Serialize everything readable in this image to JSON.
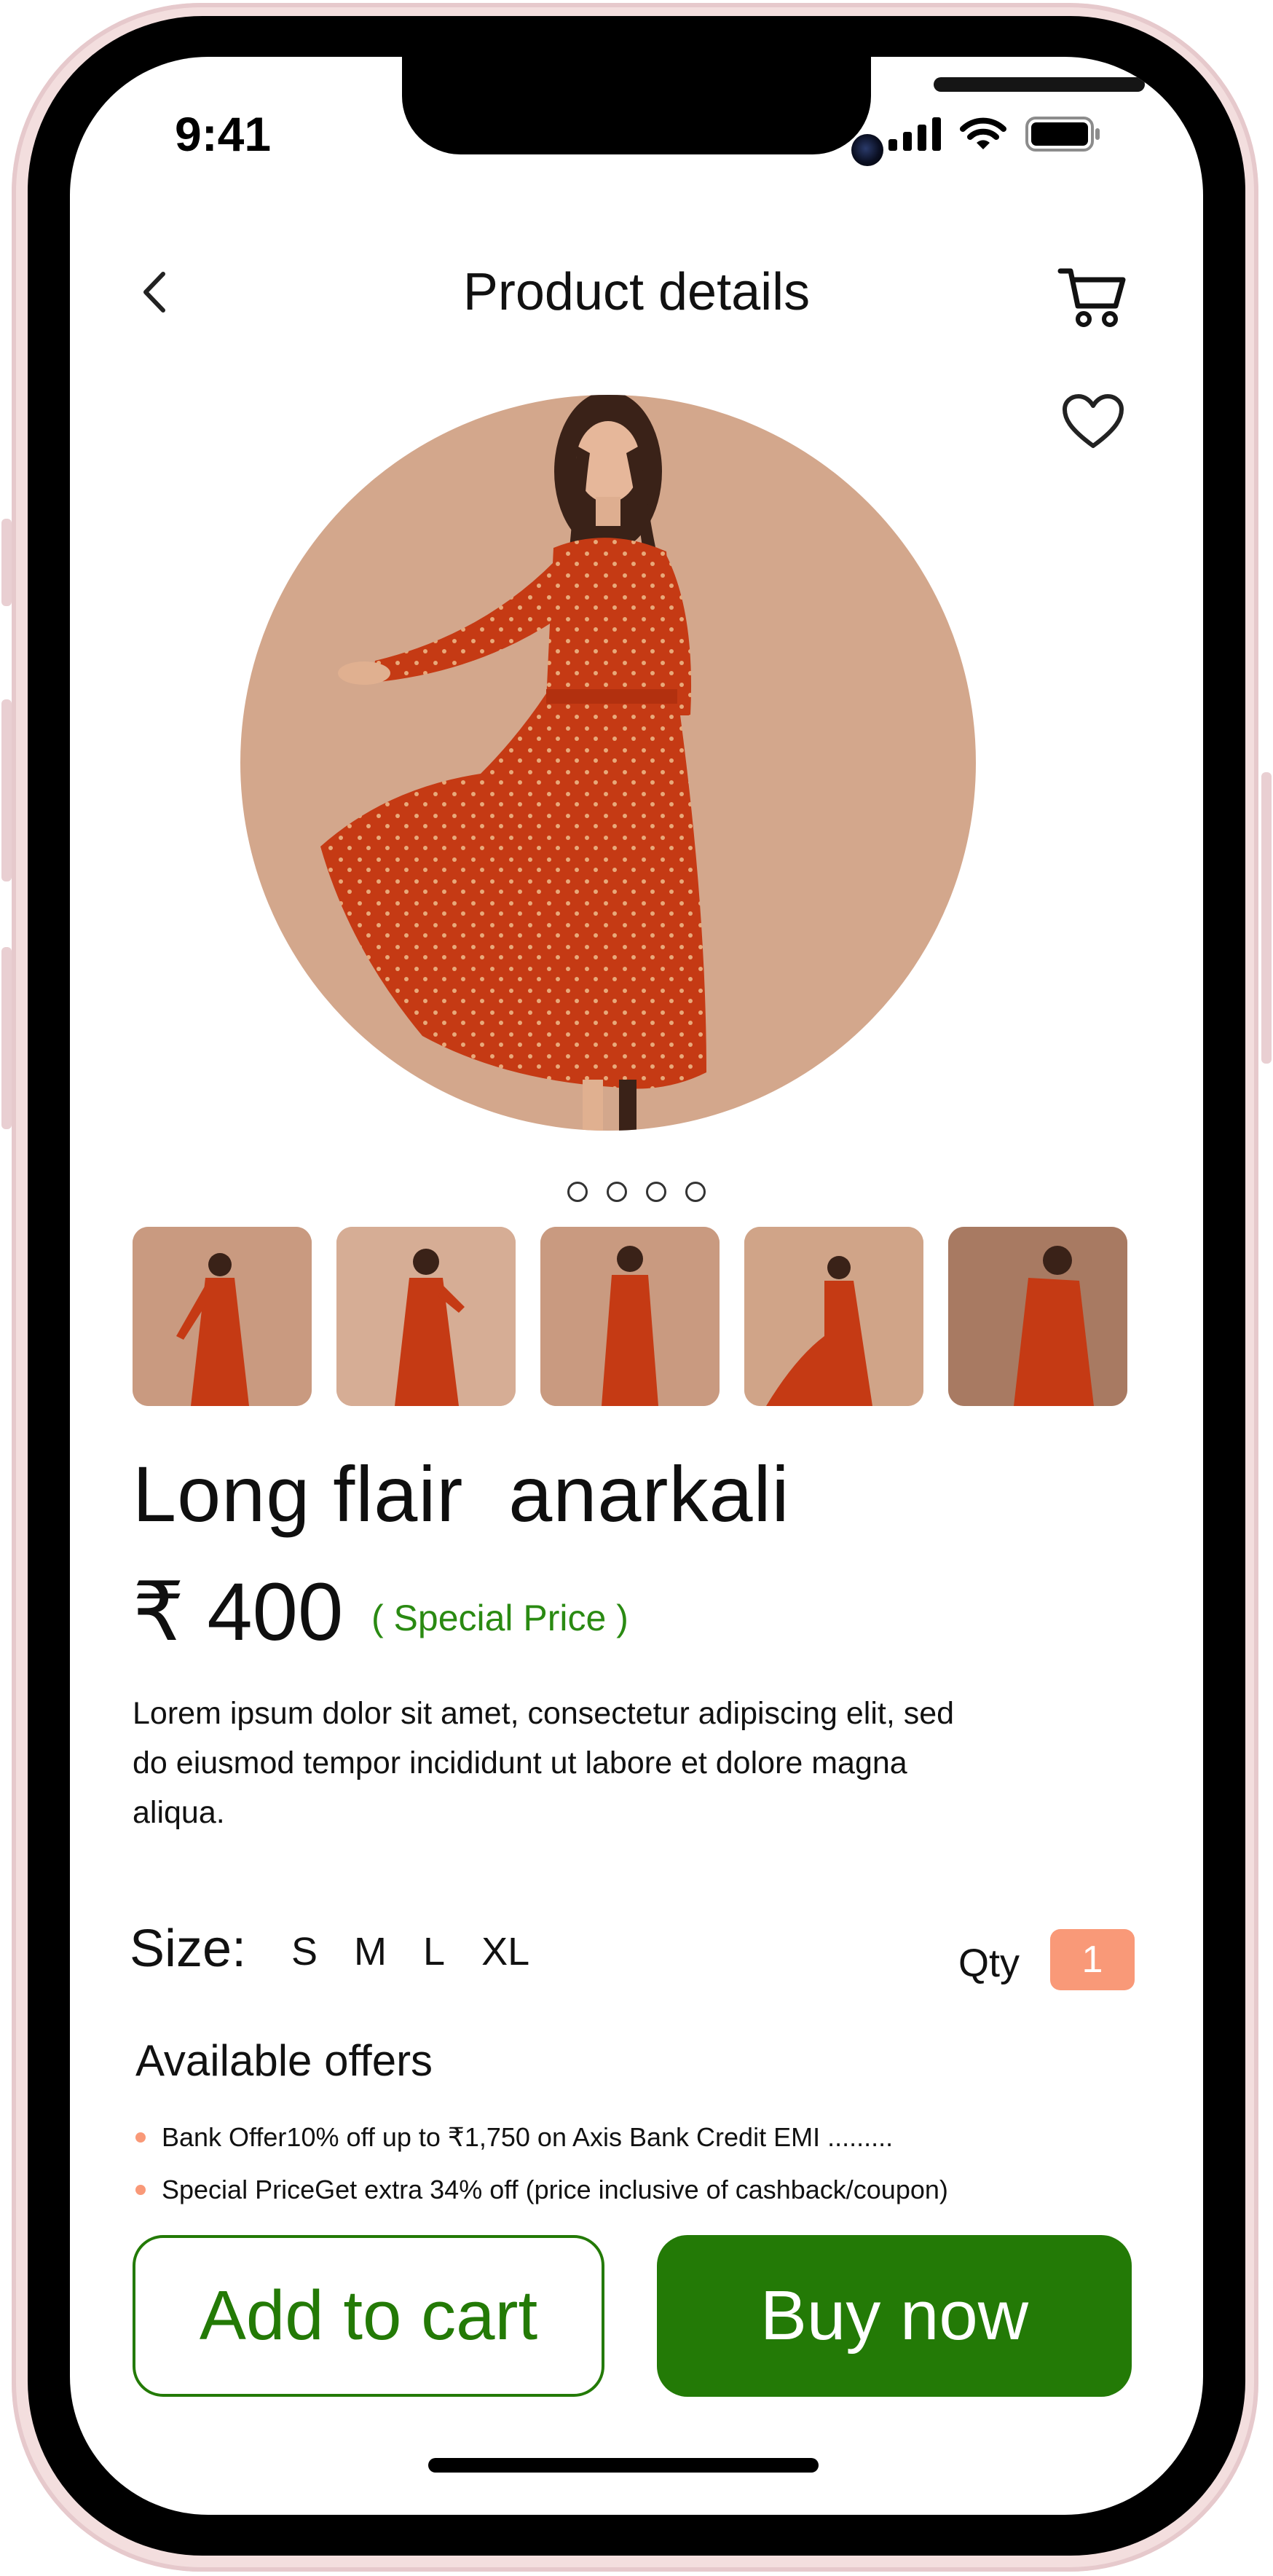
{
  "status_bar": {
    "time": "9:41"
  },
  "header": {
    "title": "Product details"
  },
  "gallery": {
    "dot_count": 4,
    "thumbnail_count": 5
  },
  "product": {
    "name": "Long flair  anarkali",
    "price": "₹ 400",
    "price_tag": "( Special Price )",
    "description": "Lorem ipsum dolor sit amet, consectetur adipiscing elit, sed do eiusmod tempor incididunt ut labore et dolore magna aliqua."
  },
  "size": {
    "label": "Size:",
    "options": [
      "S",
      "M",
      "L",
      "XL"
    ]
  },
  "quantity": {
    "label": "Qty",
    "value": "1"
  },
  "offers": {
    "title": "Available offers",
    "items": [
      "Bank Offer10% off up to ₹1,750 on Axis Bank Credit EMI .........",
      "Special PriceGet extra 34% off (price inclusive of cashback/coupon)"
    ]
  },
  "actions": {
    "add_to_cart": "Add to cart",
    "buy_now": "Buy now"
  },
  "colors": {
    "accent_green": "#237a06",
    "special_price_green": "#2a8a12",
    "qty_badge": "#f99978",
    "hero_background": "#d3a78c"
  }
}
